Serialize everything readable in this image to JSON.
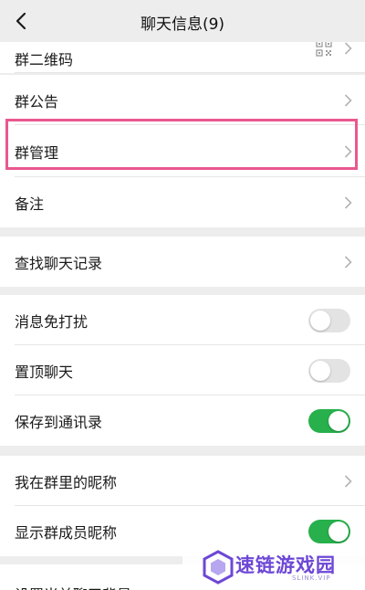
{
  "navbar": {
    "title": "聊天信息(9)"
  },
  "group1": {
    "qr_code_label": "群二维码",
    "announcement_label": "群公告",
    "manage_label": "群管理",
    "remark_label": "备注"
  },
  "group2": {
    "search_history_label": "查找聊天记录"
  },
  "group3": {
    "mute_label": "消息免打扰",
    "mute_on": false,
    "pin_label": "置顶聊天",
    "pin_on": false,
    "save_contacts_label": "保存到通讯录",
    "save_contacts_on": true
  },
  "group4": {
    "my_nickname_label": "我在群里的昵称",
    "show_nicknames_label": "显示群成员昵称",
    "show_nicknames_on": true
  },
  "group5": {
    "background_label": "设置当前聊天背景"
  },
  "highlight": {
    "color": "#e9588f",
    "target": "群管理"
  },
  "watermark": {
    "text": "速链游戏园",
    "sub": "SLINK.VIP"
  },
  "colors": {
    "toggle_on": "#27b04b",
    "toggle_off": "#e3e3e3",
    "background": "#ededed",
    "chevron": "#b2b2b2"
  }
}
